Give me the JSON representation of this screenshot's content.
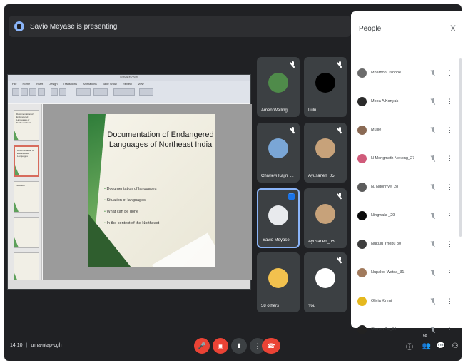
{
  "banner": {
    "text": "Savio Meyase is presenting",
    "icon": "present-icon"
  },
  "presentation": {
    "window_title": "PowerPoint",
    "tabs": [
      "File",
      "Home",
      "Insert",
      "Design",
      "Transitions",
      "Animations",
      "Slide Show",
      "Review",
      "View"
    ],
    "slide_title": "Documentation of Endangered Languages of Northeast India",
    "bullets": [
      "Documentation of languages",
      "Situation of languages",
      "What can be done",
      "In the context of the Northeast"
    ],
    "thumbs": [
      "Documentation of Endangered Languages of Northeast India",
      "Documentation of Endangered Languages",
      "Situation",
      "",
      ""
    ]
  },
  "tiles": [
    {
      "name": "Amen Walling",
      "avatar_color": "#4f8b4a"
    },
    {
      "name": "Lulu",
      "avatar_color": "#000000"
    },
    {
      "name": "Chiwievi Kajiri_...",
      "avatar_color": "#7aa6d6"
    },
    {
      "name": "Ayusanen_05",
      "avatar_color": "#c7a27a"
    },
    {
      "name": "Savio Meyase",
      "avatar_color": "#e8eaed"
    },
    {
      "name": "Ayusanen_05",
      "avatar_color": "#c7a27a"
    },
    {
      "name": "58 others",
      "avatar_color": "#f2c14e"
    },
    {
      "name": "You",
      "avatar_color": "#ffffff"
    }
  ],
  "people": {
    "title": "People",
    "close": "X",
    "list": [
      {
        "name": "Mharhoni Tsopoe",
        "color": "#6b6b6b"
      },
      {
        "name": "Mopa A Konyak",
        "color": "#2b2b2b"
      },
      {
        "name": "Mullie",
        "color": "#8a6a54"
      },
      {
        "name": "N Mongmeth Nekong_27",
        "color": "#d05b7a"
      },
      {
        "name": "N. Ngonnye_28",
        "color": "#5c5c5c"
      },
      {
        "name": "Ningwala _29",
        "color": "#0b0b0b"
      },
      {
        "name": "Nukulu Yhobu 30",
        "color": "#3e3e3e"
      },
      {
        "name": "Nupakol Wotsa_31",
        "color": "#a17a5c"
      },
      {
        "name": "Olivia Kirimi",
        "color": "#e5b81e"
      },
      {
        "name": "Otonen Ao_34",
        "color": "#222222"
      }
    ]
  },
  "bottom": {
    "time": "14:10",
    "sep": "|",
    "meeting_code": "uma-ntap-cgh",
    "controls": [
      "mic-off-icon",
      "camera-off-icon",
      "present-now-icon",
      "more-options-icon",
      "end-call-icon"
    ],
    "right_icons": [
      "info-icon",
      "people-icon",
      "chat-icon",
      "activities-icon"
    ],
    "people_badge": "68"
  },
  "colors": {
    "stage": "#202124",
    "end_call": "#ea4335",
    "accent": "#1a73e8"
  }
}
